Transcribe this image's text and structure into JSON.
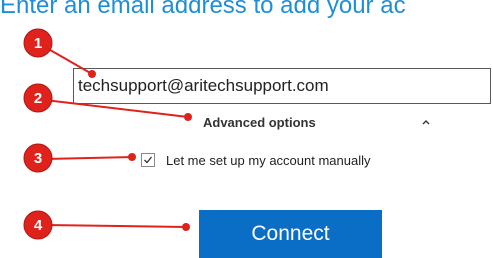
{
  "heading": "Enter an email address to add your ac",
  "email": {
    "value": "techsupport@aritechsupport.com"
  },
  "advanced": {
    "label": "Advanced options",
    "caret": "chevron-up-icon"
  },
  "manual_setup": {
    "label": "Let me set up my account manually",
    "checked": true
  },
  "connect": {
    "label": "Connect"
  },
  "annotations": {
    "badges": [
      "1",
      "2",
      "3",
      "4"
    ],
    "color": "#e0221c"
  },
  "colors": {
    "heading": "#1e8fd6",
    "button": "#0a6ec6"
  }
}
